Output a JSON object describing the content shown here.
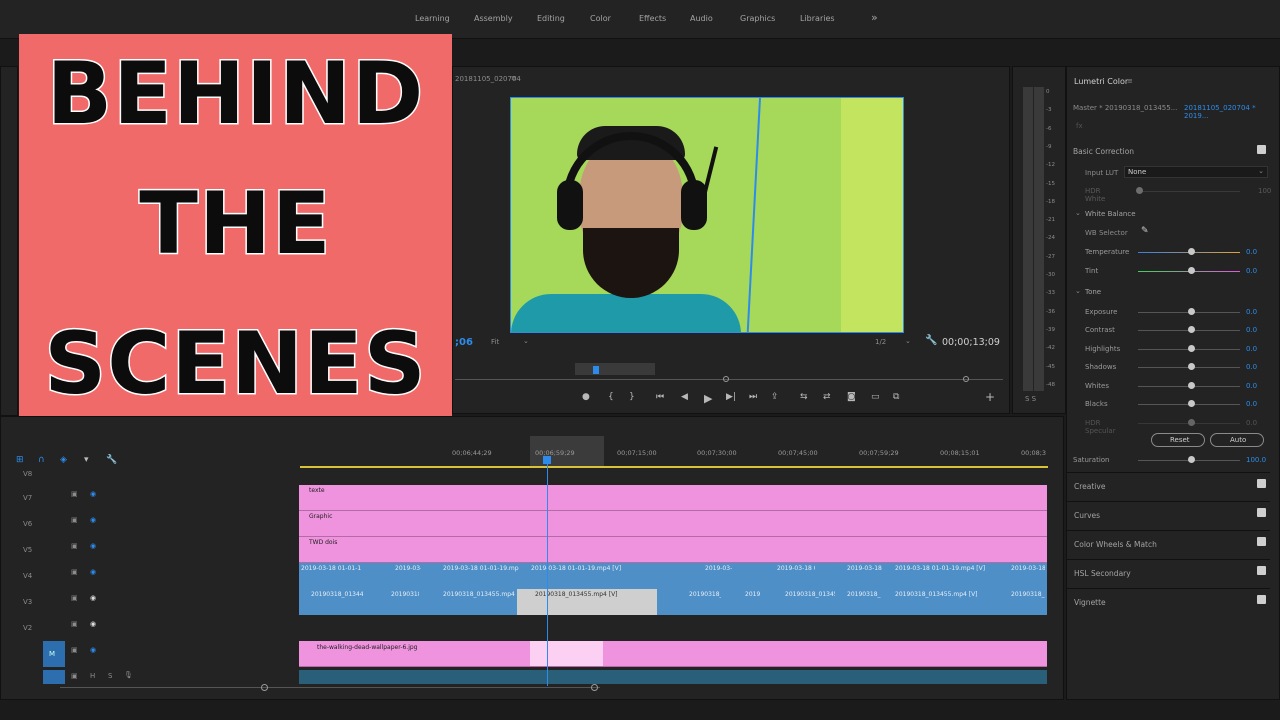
{
  "workspaces": [
    "Learning",
    "Assembly",
    "Editing",
    "Color",
    "Effects",
    "Audio",
    "Graphics",
    "Libraries"
  ],
  "workspaces_more": "»",
  "program": {
    "tab_title": "20181105_020704",
    "timecode_left": ";06",
    "fit_label": "Fit",
    "resolution": "1/2",
    "timecode_right": "00;00;13;09"
  },
  "thumbnail": {
    "line1": "BEHIND",
    "line2": "THE",
    "line3": "SCENES"
  },
  "meter_labels": [
    "0",
    "-3",
    "-6",
    "-9",
    "-12",
    "-15",
    "-18",
    "-21",
    "-24",
    "-27",
    "-30",
    "-33",
    "-36",
    "-39",
    "-42",
    "-45",
    "-48"
  ],
  "meter_bottom": "S  S",
  "lumetri": {
    "title": "Lumetri Color",
    "master": "Master * 20190318_013455...",
    "sequence": "20181105_020704 * 2019...",
    "fx": "fx",
    "basic_correction": "Basic Correction",
    "input_lut_label": "Input LUT",
    "input_lut_value": "None",
    "hdr_white": "HDR White",
    "hdr_white_value": "100",
    "white_balance": "White Balance",
    "wb_selector": "WB Selector",
    "temperature": "Temperature",
    "tint": "Tint",
    "tone": "Tone",
    "tone_rows": [
      {
        "label": "Exposure",
        "value": "0.0"
      },
      {
        "label": "Contrast",
        "value": "0.0"
      },
      {
        "label": "Highlights",
        "value": "0.0"
      },
      {
        "label": "Shadows",
        "value": "0.0"
      },
      {
        "label": "Whites",
        "value": "0.0"
      },
      {
        "label": "Blacks",
        "value": "0.0"
      },
      {
        "label": "HDR Specular",
        "value": "0.0"
      }
    ],
    "temp_value": "0.0",
    "tint_value": "0.0",
    "reset": "Reset",
    "auto": "Auto",
    "saturation": "Saturation",
    "saturation_value": "100.0",
    "sections": [
      "Creative",
      "Curves",
      "Color Wheels & Match",
      "HSL Secondary",
      "Vignette"
    ]
  },
  "timeline": {
    "timecodes": [
      "00;06;44;29",
      "00;06;59;29",
      "00;07;15;00",
      "00;07;30;00",
      "00;07;45;00",
      "00;07;59;29",
      "00;08;15;01",
      "00;08;3"
    ],
    "tracks": [
      {
        "name": "V8"
      },
      {
        "name": "V7"
      },
      {
        "name": "V6"
      },
      {
        "name": "V5"
      },
      {
        "name": "V4"
      },
      {
        "name": "V3"
      },
      {
        "name": "V2"
      },
      {
        "name": "V1"
      }
    ],
    "clip_v7": "texte",
    "clip_v6": "Graphic",
    "clip_v5": "TWD dois",
    "clip_v1": "the-walking-dead-wallpaper-6.jpg",
    "v4_clips": [
      "2019-03-18 01-01-19",
      "2019-03-1",
      "2019-03-18 01-01-19.mp4 [V]",
      "2019-03-18 01-01-19.mp4 [V]",
      "2019-03-18",
      "2019-03-18 01-01",
      "2019-03-18",
      "2019-03-18 01-01-19.mp4 [V]",
      "2019-03-18"
    ],
    "v3_clips": [
      "20190318_01344",
      "20190318_",
      "20190318_013455.mp4 [V]",
      "20190318_013455.mp4 [V]",
      "20190318_",
      "2019",
      "20190318_013455",
      "20190318_",
      "20190318_013455.mp4 [V]",
      "20190318_"
    ],
    "m_label": "M",
    "h_label": "H",
    "s_label": "S"
  },
  "colors": {
    "accent": "#2d8ceb",
    "clip_pink": "#ef93de",
    "clip_blue": "#4f8fc7",
    "thumb_bg": "#f16a6a",
    "video_green": "#a6d85a"
  }
}
